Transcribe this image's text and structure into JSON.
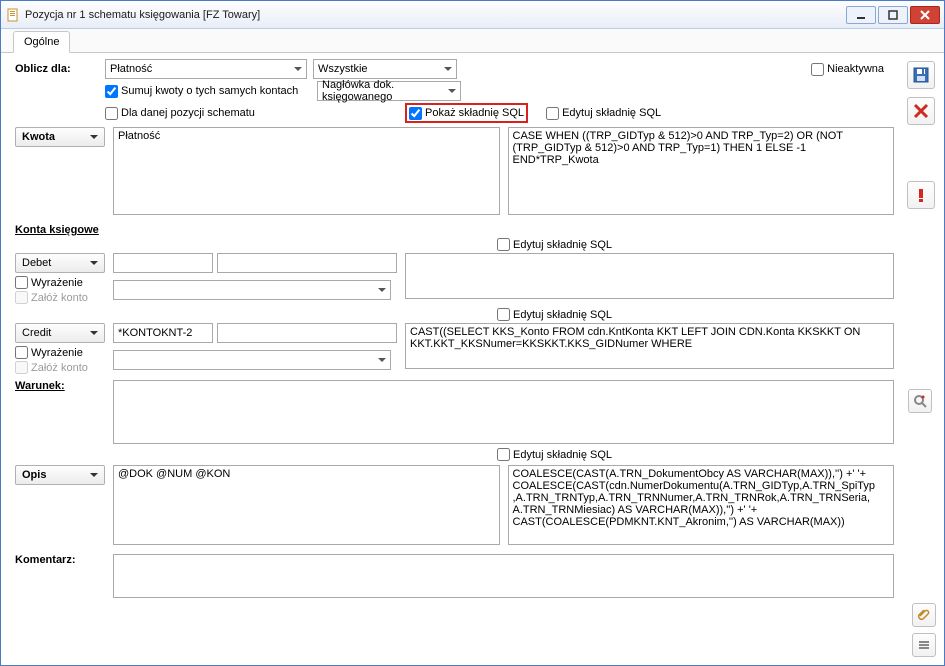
{
  "window": {
    "title": "Pozycja nr 1 schematu księgowania [FZ Towary]"
  },
  "tab": "Ogólne",
  "topbar": {
    "oblicz_label": "Oblicz dla:",
    "select1": "Płatność",
    "select2": "Wszystkie",
    "inactive_label": "Nieaktywna",
    "sum_label": "Sumuj kwoty o tych samych kontach",
    "header_select": "Nagłówka dok. księgowanego",
    "dla_label": "Dla danej pozycji schematu",
    "pokaz_label": "Pokaż składnię SQL"
  },
  "edytuj_label": "Edytuj składnię SQL",
  "kwota": {
    "label": "Kwota",
    "left_value": "Płatność",
    "right_value": "CASE WHEN ((TRP_GIDTyp & 512)>0 AND TRP_Typ=2) OR (NOT (TRP_GIDTyp & 512)>0 AND TRP_Typ=1) THEN 1 ELSE -1 END*TRP_Kwota"
  },
  "konta": {
    "title": "Konta księgowe",
    "debet": "Debet",
    "credit": "Credit",
    "wyrazenie": "Wyrażenie",
    "zaloz": "Załóż konto",
    "credit_value": "*KONTOKNT-2",
    "credit_sql": "CAST((SELECT KKS_Konto FROM cdn.KntKonta KKT LEFT JOIN CDN.Konta KKSKKT ON KKT.KKT_KKSNumer=KKSKKT.KKS_GIDNumer WHERE"
  },
  "warunek": {
    "label": "Warunek:"
  },
  "opis": {
    "label": "Opis",
    "left_value": "@DOK @NUM @KON",
    "right_value": "COALESCE(CAST(A.TRN_DokumentObcy AS VARCHAR(MAX)),'') +' '+\nCOALESCE(CAST(cdn.NumerDokumentu(A.TRN_GIDTyp,A.TRN_SpiTyp,A.TRN_TRNTyp,A.TRN_TRNNumer,A.TRN_TRNRok,A.TRN_TRNSeria,A.TRN_TRNMiesiac) AS VARCHAR(MAX)),'') +' '+\nCAST(COALESCE(PDMKNT.KNT_Akronim,'') AS VARCHAR(MAX))"
  },
  "komentarz": {
    "label": "Komentarz:"
  }
}
